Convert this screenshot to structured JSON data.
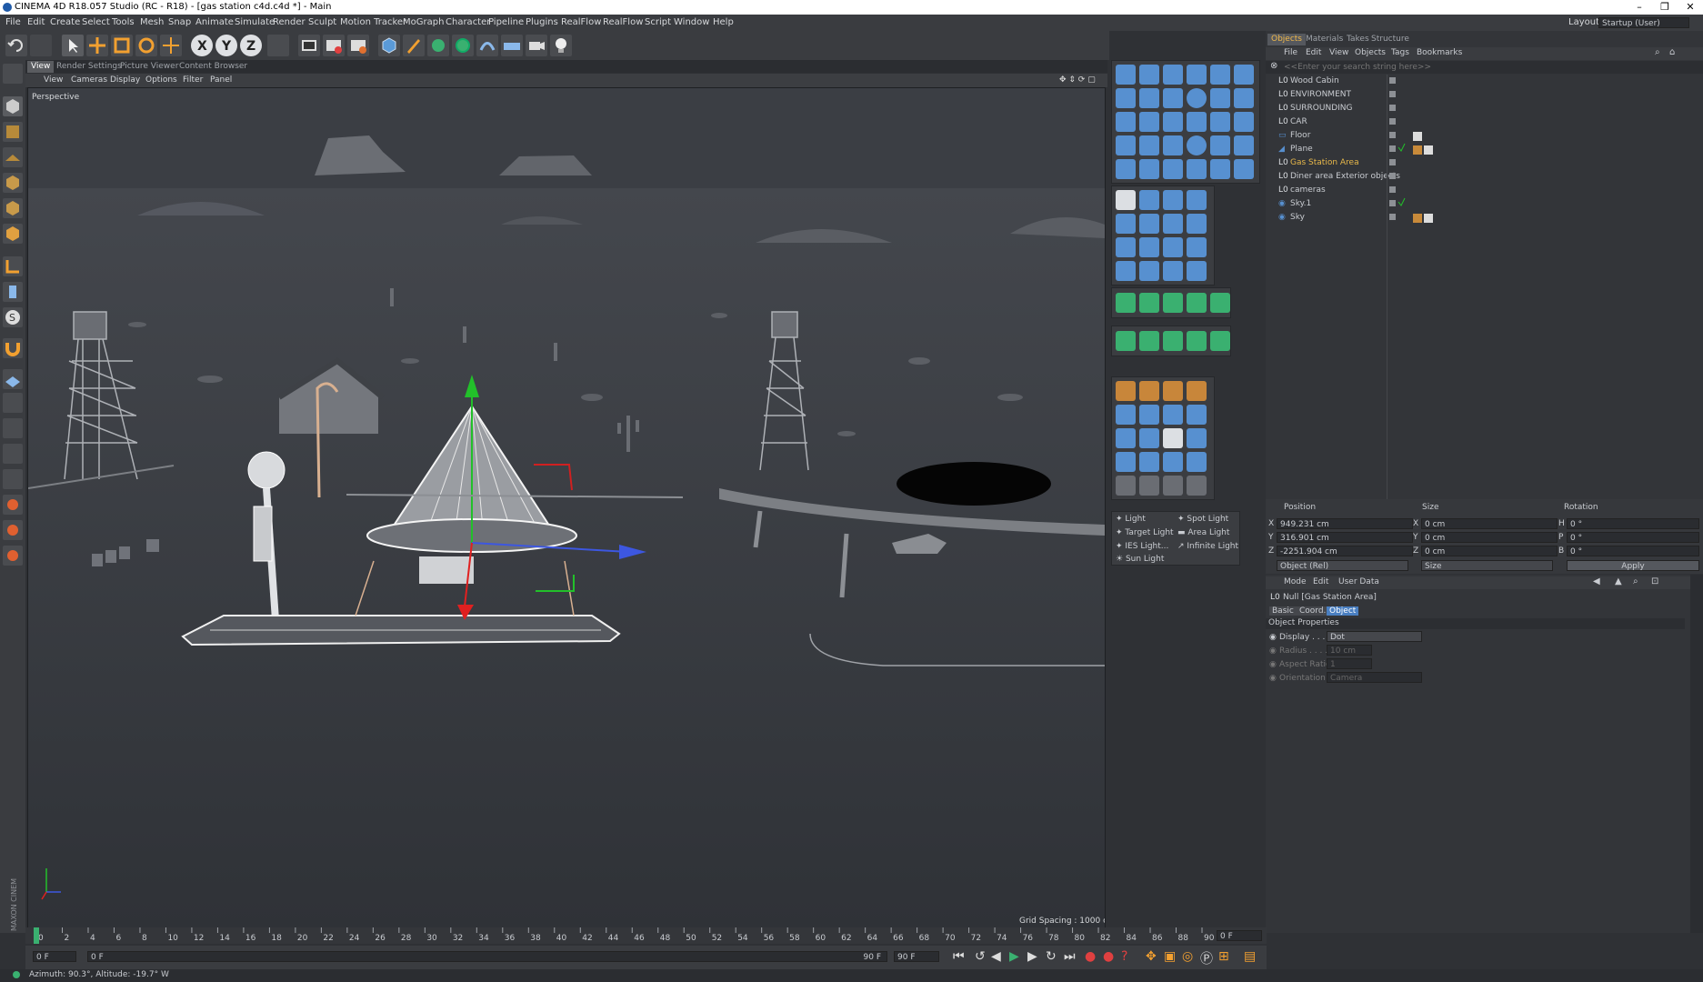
{
  "window": {
    "title": "CINEMA 4D R18.057 Studio (RC - R18) - [gas station c4d.c4d *] - Main",
    "layout_label": "Layout:",
    "layout_value": "Startup (User)"
  },
  "menu": [
    "File",
    "Edit",
    "Create",
    "Select",
    "Tools",
    "Mesh",
    "Snap",
    "Animate",
    "Simulate",
    "Render",
    "Sculpt",
    "Motion Tracker",
    "MoGraph",
    "Character",
    "Pipeline",
    "Plugins",
    "RealFlow",
    "RealFlow",
    "Script",
    "Window",
    "Help"
  ],
  "toolbar": {
    "axis_labels": [
      "X",
      "Y",
      "Z"
    ]
  },
  "viewport": {
    "tabs": [
      "View",
      "Render Settings",
      "Picture Viewer",
      "Content Browser"
    ],
    "menu": [
      "View",
      "Cameras",
      "Display",
      "Options",
      "Filter",
      "Panel"
    ],
    "camera_label": "Perspective",
    "grid_spacing": "Grid Spacing : 1000 cm"
  },
  "light_palette": {
    "items": [
      "Light",
      "Spot Light",
      "Target Light",
      "Area Light",
      "IES Light...",
      "Infinite Light",
      "Sun Light"
    ]
  },
  "object_manager": {
    "tabs": [
      "Objects",
      "Materials",
      "Takes",
      "Structure"
    ],
    "menu": [
      "File",
      "Edit",
      "View",
      "Objects",
      "Tags",
      "Bookmarks"
    ],
    "search_placeholder": "<<Enter your search string here>>",
    "objects": [
      {
        "name": "Wood Cabin",
        "highlight": false,
        "indent": 0
      },
      {
        "name": "ENVIRONMENT",
        "highlight": false,
        "indent": 0
      },
      {
        "name": "SURROUNDING",
        "highlight": false,
        "indent": 0
      },
      {
        "name": "CAR",
        "highlight": false,
        "indent": 0
      },
      {
        "name": "Floor",
        "highlight": false,
        "indent": 1
      },
      {
        "name": "Plane",
        "highlight": false,
        "indent": 1
      },
      {
        "name": "Gas Station Area",
        "highlight": true,
        "indent": 0
      },
      {
        "name": "Diner area Exterior objects",
        "highlight": false,
        "indent": 0
      },
      {
        "name": "cameras",
        "highlight": false,
        "indent": 0
      },
      {
        "name": "Sky.1",
        "highlight": false,
        "indent": 1
      },
      {
        "name": "Sky",
        "highlight": false,
        "indent": 1
      }
    ]
  },
  "coordinates": {
    "headers": [
      "Position",
      "Size",
      "Rotation"
    ],
    "position": [
      {
        "axis": "X",
        "value": "949.231 cm"
      },
      {
        "axis": "Y",
        "value": "316.901 cm"
      },
      {
        "axis": "Z",
        "value": "-2251.904 cm"
      }
    ],
    "size": [
      {
        "axis": "X",
        "value": "0 cm"
      },
      {
        "axis": "Y",
        "value": "0 cm"
      },
      {
        "axis": "Z",
        "value": "0 cm"
      }
    ],
    "rotation": [
      {
        "axis": "H",
        "value": "0 °"
      },
      {
        "axis": "P",
        "value": "0 °"
      },
      {
        "axis": "B",
        "value": "0 °"
      }
    ],
    "mode_select": "Object (Rel)",
    "size_select": "Size",
    "apply_label": "Apply"
  },
  "attributes": {
    "menu": [
      "Mode",
      "Edit",
      "User Data"
    ],
    "object_title": "Null [Gas Station Area]",
    "tabs": [
      "Basic",
      "Coord.",
      "Object"
    ],
    "section": "Object Properties",
    "props": [
      {
        "label": "Display . . . . .",
        "value": "Dot"
      },
      {
        "label": "Radius . . . . .",
        "value": "10 cm"
      },
      {
        "label": "Aspect Ratio",
        "value": "1"
      },
      {
        "label": "Orientation",
        "value": "Camera"
      }
    ]
  },
  "timeline": {
    "ticks": [
      "0",
      "2",
      "4",
      "6",
      "8",
      "10",
      "12",
      "14",
      "16",
      "18",
      "20",
      "22",
      "24",
      "26",
      "28",
      "30",
      "32",
      "34",
      "36",
      "38",
      "40",
      "42",
      "44",
      "46",
      "48",
      "50",
      "52",
      "54",
      "56",
      "58",
      "60",
      "62",
      "64",
      "66",
      "68",
      "70",
      "72",
      "74",
      "76",
      "78",
      "80",
      "82",
      "84",
      "86",
      "88",
      "90"
    ],
    "current_frame": "0 F",
    "start_field": "0 F",
    "start_field2": "0 F",
    "end_field": "90 F",
    "end_field2": "90 F"
  },
  "status": {
    "text": "Azimuth: 90.3°, Altitude: -19.7°  W"
  },
  "branding": {
    "vertical": "MAXON CINEMA 4D"
  },
  "colors": {
    "accent": "#4a7fc1",
    "highlight_text": "#e8b84a",
    "axis_x": "#3d57e0",
    "axis_y": "#22c02a",
    "axis_z": "#e02020"
  }
}
